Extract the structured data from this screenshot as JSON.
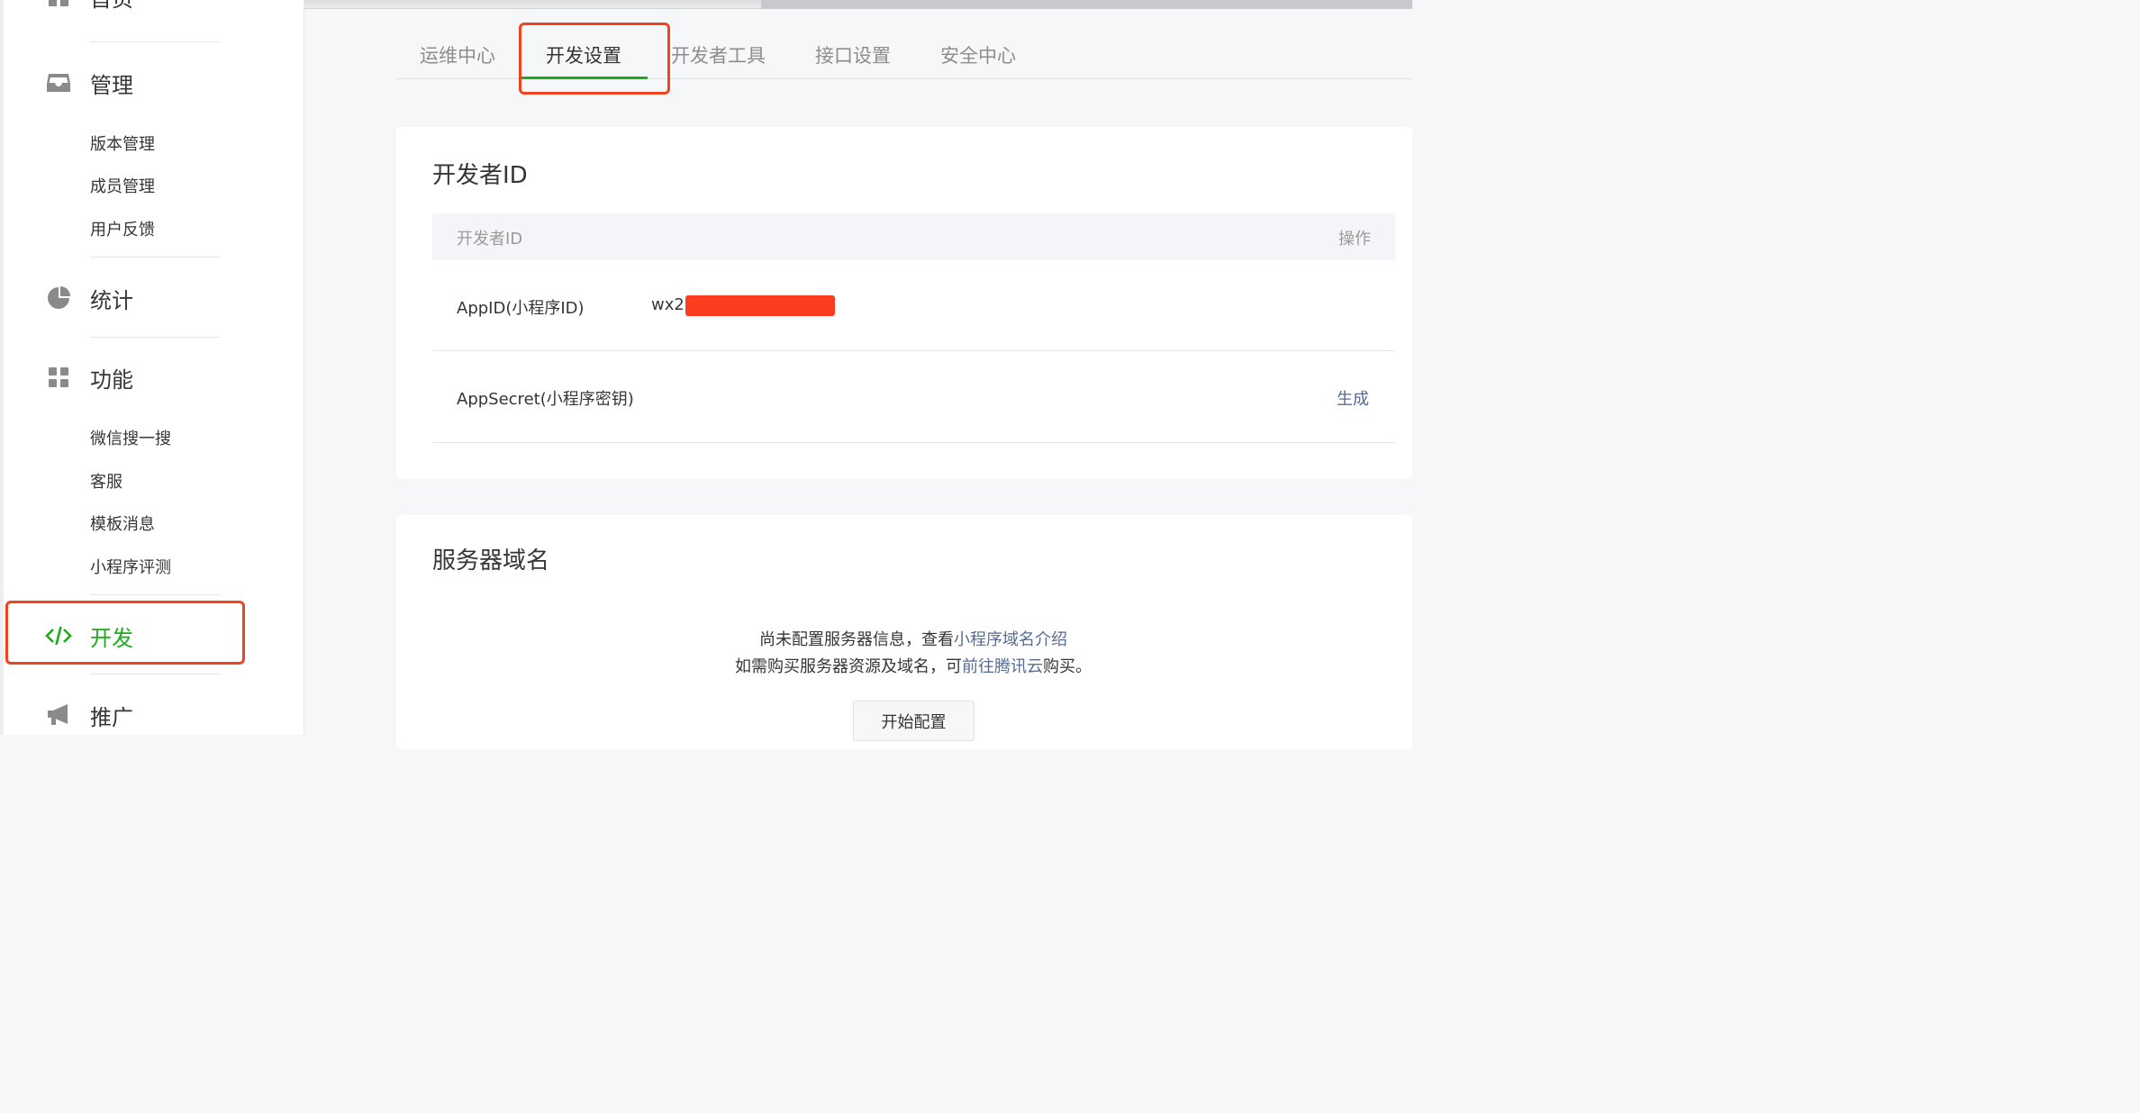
{
  "sidebar": {
    "home_label": "首页",
    "sections": {
      "manage": {
        "label": "管理",
        "icon": "inbox-icon",
        "items": [
          "版本管理",
          "成员管理",
          "用户反馈"
        ]
      },
      "stats": {
        "label": "统计",
        "icon": "pie-chart-icon"
      },
      "features": {
        "label": "功能",
        "icon": "grid-icon",
        "items": [
          "微信搜一搜",
          "客服",
          "模板消息",
          "小程序评测"
        ]
      },
      "develop": {
        "label": "开发",
        "icon": "code-icon"
      },
      "promote": {
        "label": "推广",
        "icon": "megaphone-icon"
      }
    }
  },
  "tabs": [
    "运维中心",
    "开发设置",
    "开发者工具",
    "接口设置",
    "安全中心"
  ],
  "active_tab": "开发设置",
  "developer_id_card": {
    "title": "开发者ID",
    "table_header": {
      "col1": "开发者ID",
      "col2": "操作"
    },
    "rows": [
      {
        "label": "AppID(小程序ID)",
        "value": "wx21",
        "action": ""
      },
      {
        "label": "AppSecret(小程序密钥)",
        "value": "",
        "action": "生成"
      }
    ]
  },
  "server_domain_card": {
    "title": "服务器域名",
    "line1_prefix": "尚未配置服务器信息，查看",
    "line1_link": "小程序域名介绍",
    "line2_prefix": "如需购买服务器资源及域名，可",
    "line2_link": "前往腾讯云",
    "line2_suffix": "购买。",
    "button": "开始配置"
  },
  "colors": {
    "accent": "#1aad19",
    "link": "#576b95",
    "highlight_box": "#f0441f",
    "redaction": "#fb3c1e"
  }
}
